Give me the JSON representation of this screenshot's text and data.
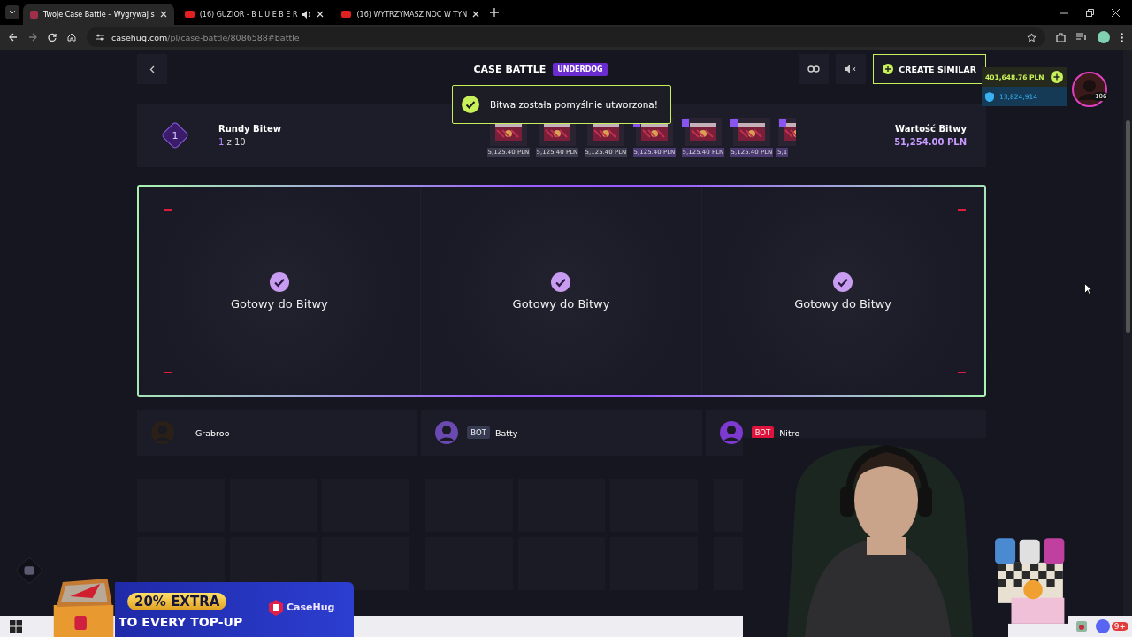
{
  "browser": {
    "tabs": [
      {
        "title": "Twoje Case Battle – Wygrywaj s",
        "selected": true,
        "audio": false
      },
      {
        "title": "(16) GUZIOR - B L U E B E R",
        "selected": false,
        "audio": true
      },
      {
        "title": "(16) WYTRZYMASZ NOC W TYN",
        "selected": false,
        "audio": false
      }
    ],
    "address": {
      "host": "casehug.com",
      "path": "/pl/case-battle/8086588#battle"
    }
  },
  "header": {
    "title": "CASE BATTLE",
    "mode": "UNDERDOG",
    "create_button": "CREATE SIMILAR"
  },
  "wallet": {
    "balance": "401,648.76 PLN",
    "coins": "13,824,914",
    "level": "106"
  },
  "toast": {
    "message": "Bitwa została pomyślnie utworzona!"
  },
  "rounds": {
    "label": "Rundy Bitew",
    "badge": "1",
    "current": "1",
    "of": "z 10",
    "value_label": "Wartość Bitwy",
    "value": "51,254.00 PLN",
    "cases": [
      {
        "price": "5,125.40 PLN",
        "bonus": false
      },
      {
        "price": "5,125.40 PLN",
        "bonus": false
      },
      {
        "price": "5,125.40 PLN",
        "bonus": false
      },
      {
        "price": "5,125.40 PLN",
        "bonus": true
      },
      {
        "price": "5,125.40 PLN",
        "bonus": true
      },
      {
        "price": "5,125.40 PLN",
        "bonus": true
      },
      {
        "price": "5,1",
        "bonus": true
      }
    ]
  },
  "arena": {
    "slots": [
      {
        "status": "Gotowy do Bitwy",
        "ready": true
      },
      {
        "status": "Gotowy do Bitwy",
        "ready": true
      },
      {
        "status": "Gotowy do Bitwy",
        "ready": true
      }
    ]
  },
  "players": [
    {
      "name": "Grabroo"
    },
    {
      "name": "Batty",
      "tag": {
        "label": "BOT",
        "color": "#363b52"
      }
    },
    {
      "name": "Nitro",
      "tag": {
        "label": "BOT",
        "color": "#e0133d"
      }
    }
  ],
  "ad": {
    "headline": "20% EXTRA",
    "subline": "TO EVERY TOP-UP",
    "brand": "CaseHug"
  },
  "taskbar": {
    "notification_count": "9+"
  }
}
